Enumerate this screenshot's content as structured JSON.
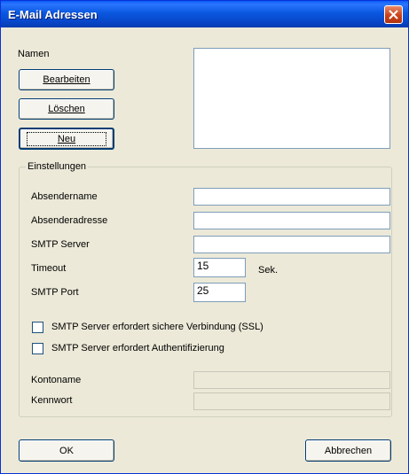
{
  "window": {
    "title": "E-Mail Adressen"
  },
  "names": {
    "label": "Namen",
    "edit_button": "Bearbeiten",
    "delete_button": "Löschen",
    "new_button": "Neu"
  },
  "settings": {
    "group_label": "Einstellungen",
    "sender_name_label": "Absendername",
    "sender_address_label": "Absenderadresse",
    "smtp_server_label": "SMTP Server",
    "timeout_label": "Timeout",
    "timeout_value": "15",
    "timeout_unit": "Sek.",
    "smtp_port_label": "SMTP Port",
    "smtp_port_value": "25",
    "ssl_checkbox_label": "SMTP Server erfordert sichere Verbindung (SSL)",
    "auth_checkbox_label": "SMTP Server erfordert Authentifizierung",
    "account_label": "Kontoname",
    "password_label": "Kennwort"
  },
  "footer": {
    "ok_button": "OK",
    "cancel_button": "Abbrechen"
  },
  "colors": {
    "title_bar": "#0a58e0",
    "dialog_bg": "#ece9d8",
    "close_button": "#c9421b"
  },
  "icons": {
    "close": "close-icon"
  }
}
